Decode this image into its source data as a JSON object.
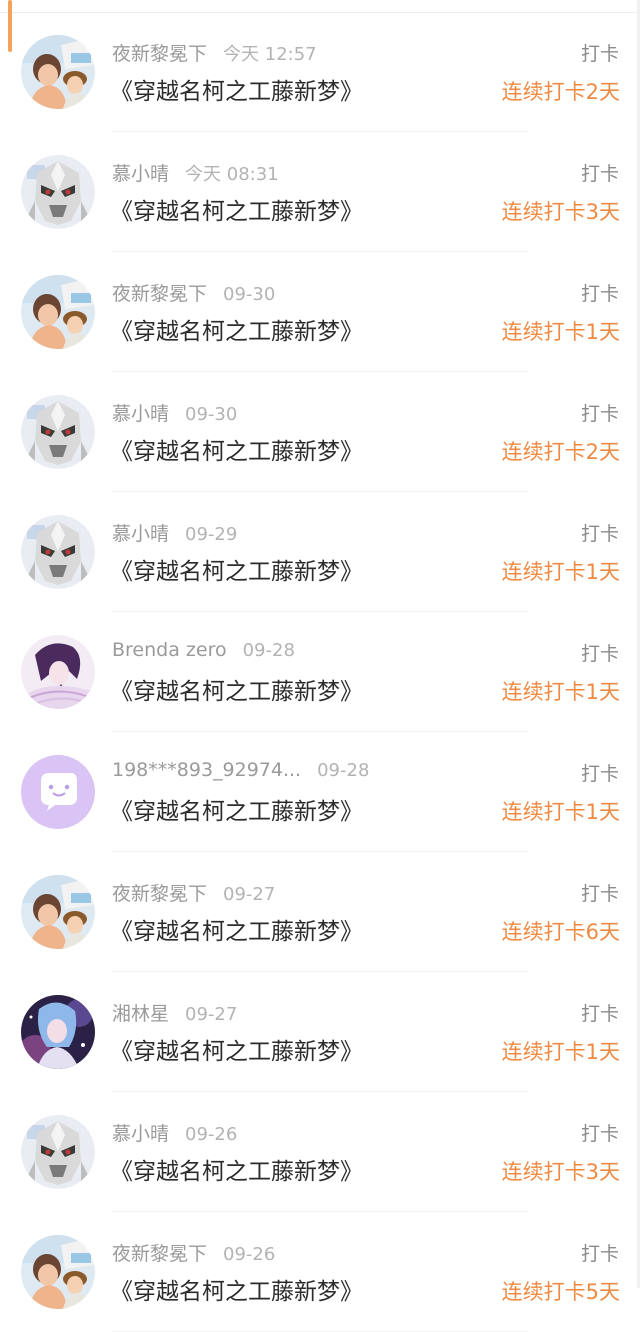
{
  "colors": {
    "accent": "#ee8a43",
    "name_text": "#9a9a9a",
    "time_text": "#b3b3b3",
    "title_text": "#2b2b2b",
    "action_text": "#8a8a8a",
    "divider": "#f1f1f1"
  },
  "checkins": [
    {
      "avatar": "anime-couple-avatar",
      "name": "夜新黎冕下",
      "time": "今天 12:57",
      "book": "《穿越名柯之工藤新梦》",
      "action": "打卡",
      "streak": "连续打卡2天"
    },
    {
      "avatar": "robot-helmet-avatar",
      "name": "慕小晴",
      "time": "今天 08:31",
      "book": "《穿越名柯之工藤新梦》",
      "action": "打卡",
      "streak": "连续打卡3天"
    },
    {
      "avatar": "anime-couple-avatar",
      "name": "夜新黎冕下",
      "time": "09-30",
      "book": "《穿越名柯之工藤新梦》",
      "action": "打卡",
      "streak": "连续打卡1天"
    },
    {
      "avatar": "robot-helmet-avatar",
      "name": "慕小晴",
      "time": "09-30",
      "book": "《穿越名柯之工藤新梦》",
      "action": "打卡",
      "streak": "连续打卡2天"
    },
    {
      "avatar": "robot-helmet-avatar",
      "name": "慕小晴",
      "time": "09-29",
      "book": "《穿越名柯之工藤新梦》",
      "action": "打卡",
      "streak": "连续打卡1天"
    },
    {
      "avatar": "anime-purple-hair-avatar",
      "name": "Brenda zero",
      "time": "09-28",
      "book": "《穿越名柯之工藤新梦》",
      "action": "打卡",
      "streak": "连续打卡1天"
    },
    {
      "avatar": "default-chat-bubble-avatar",
      "name": "198***893_92974...",
      "time": "09-28",
      "book": "《穿越名柯之工藤新梦》",
      "action": "打卡",
      "streak": "连续打卡1天"
    },
    {
      "avatar": "anime-couple-avatar",
      "name": "夜新黎冕下",
      "time": "09-27",
      "book": "《穿越名柯之工藤新梦》",
      "action": "打卡",
      "streak": "连续打卡6天"
    },
    {
      "avatar": "anime-galaxy-avatar",
      "name": "湘林星",
      "time": "09-27",
      "book": "《穿越名柯之工藤新梦》",
      "action": "打卡",
      "streak": "连续打卡1天"
    },
    {
      "avatar": "robot-helmet-avatar",
      "name": "慕小晴",
      "time": "09-26",
      "book": "《穿越名柯之工藤新梦》",
      "action": "打卡",
      "streak": "连续打卡3天"
    },
    {
      "avatar": "anime-couple-avatar",
      "name": "夜新黎冕下",
      "time": "09-26",
      "book": "《穿越名柯之工藤新梦》",
      "action": "打卡",
      "streak": "连续打卡5天"
    }
  ]
}
